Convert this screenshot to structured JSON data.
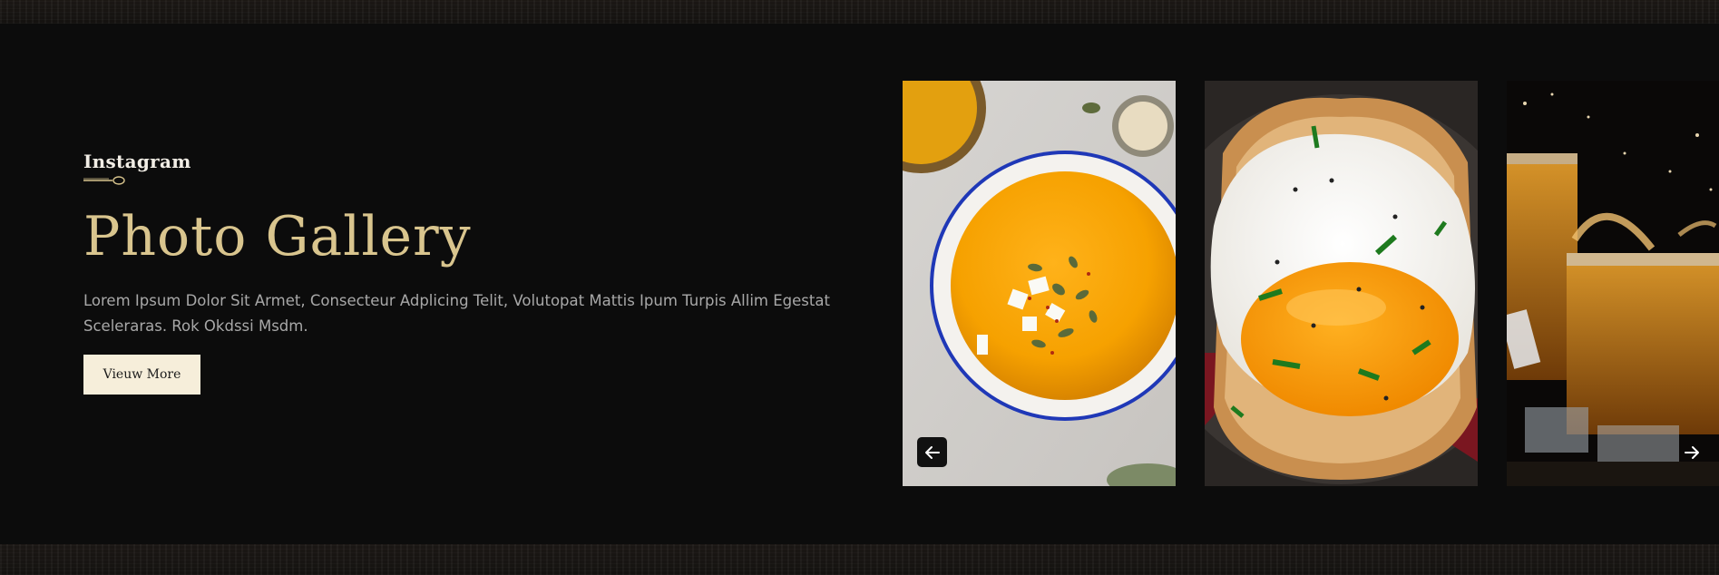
{
  "section": {
    "eyebrow": "Instagram",
    "title": "Photo Gallery",
    "description": "Lorem Ipsum Dolor Sit Armet, Consecteur Adplicing Telit, Volutopat Mattis Ipum Turpis Allim Egestat Sceleraras. Rok Okdssi Msdm.",
    "button_label": "Vieuw More"
  },
  "gallery": {
    "images": [
      {
        "name": "pumpkin-soup-photo"
      },
      {
        "name": "fried-egg-toast-photo"
      },
      {
        "name": "whiskey-glasses-photo"
      }
    ],
    "prev_icon": "arrow-left-icon",
    "next_icon": "arrow-right-icon"
  },
  "colors": {
    "background": "#0c0c0c",
    "title_gold": "#d9c58e",
    "button_bg": "#f6eeda",
    "text_muted": "#a8a8a8"
  }
}
